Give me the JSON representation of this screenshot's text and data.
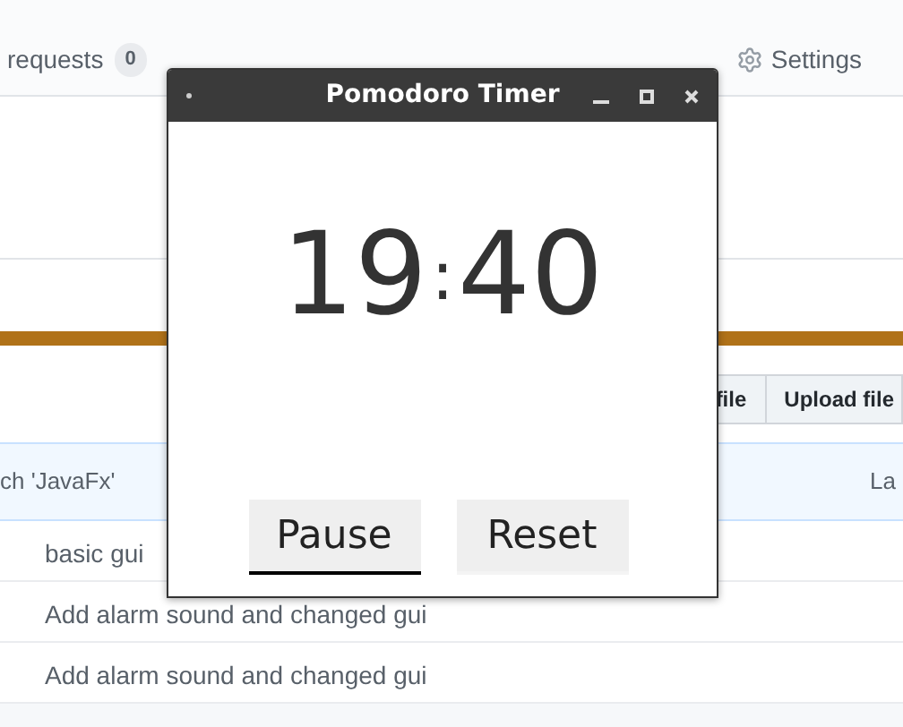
{
  "repo_tabs": [
    {
      "label": "requests",
      "count": "0"
    },
    {
      "label": "Settings"
    }
  ],
  "file_buttons": [
    "file",
    "Upload file"
  ],
  "commit_bar": {
    "message": "ch 'JavaFx'",
    "latest": "La"
  },
  "files": [
    {
      "message": "basic gui"
    },
    {
      "message": "Add alarm sound and changed gui"
    },
    {
      "message": "Add alarm sound and changed gui"
    }
  ],
  "window": {
    "title": "Pomodoro Timer",
    "timer": {
      "minutes": "19",
      "separator": ":",
      "seconds": "40"
    },
    "buttons": [
      {
        "label": "Pause",
        "focused": true
      },
      {
        "label": "Reset",
        "focused": false
      }
    ]
  }
}
